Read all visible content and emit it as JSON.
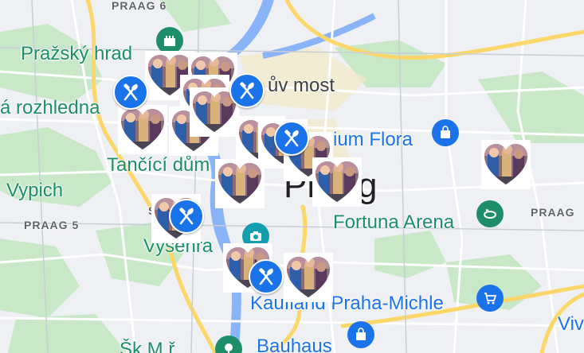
{
  "labels": {
    "praag6_top": "PRAAG 6",
    "prazsky_hrad": "Pražský hrad",
    "rozhledna": "á rozhledna",
    "karluv_most": "ův most",
    "palladium_flora": "ium Flora",
    "tancici_dum": "Tančící dům",
    "vypich": "Vypich",
    "praag5": "PRAAG 5",
    "praag_city": "Praag",
    "fortuna_arena": "Fortuna Arena",
    "praag_right": "PRAAG",
    "vysehrad": "Vyšehra",
    "kaufland": "Kaufland Praha-Michle",
    "vi_right": "Viv",
    "bauhaus": "Bauhaus",
    "bottom_left": "Šk  M  ř",
    "sv_fragment": "S"
  },
  "icons": {
    "castle": "castle-icon",
    "shopping_bag": "shopping-bag-icon",
    "stadium": "stadium-icon",
    "camera": "camera-icon",
    "cart": "shopping-cart-icon",
    "park": "park-icon",
    "restaurant": "restaurant-icon",
    "heart_photo": "heart-photo-icon"
  },
  "colors": {
    "map_background": "#eef0f3",
    "park_green": "#c8e8c8",
    "water": "#8ab4f8",
    "major_road": "#fbd769",
    "poi_green": "#1e8e6a",
    "poi_blue": "#1a73e8",
    "restaurant_marker": "#1a73e8"
  }
}
